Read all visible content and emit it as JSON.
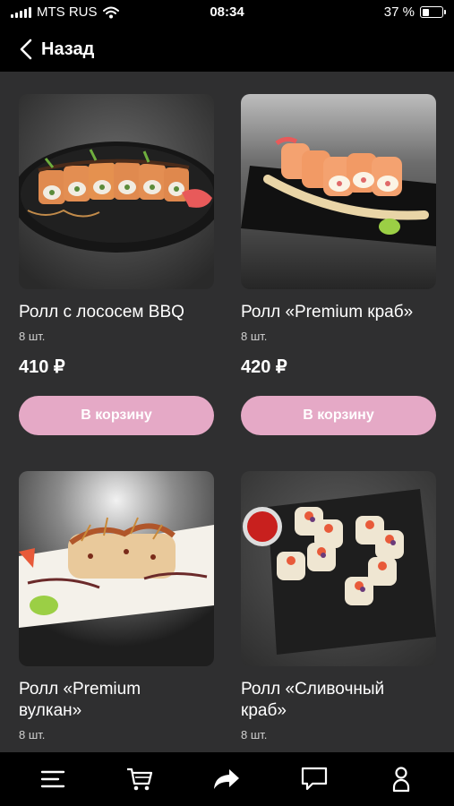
{
  "status_bar": {
    "carrier": "MTS RUS",
    "time": "08:34",
    "battery_percent_label": "37 %",
    "battery_level": 0.37
  },
  "nav": {
    "back_label": "Назад"
  },
  "products": [
    {
      "title": "Ролл с  лососем BBQ",
      "quantity": "8 шт.",
      "price": "410 ₽",
      "button": "В корзину",
      "image": "salmon-bbq-roll-photo"
    },
    {
      "title": "Ролл «Premium краб»",
      "quantity": "8 шт.",
      "price": "420 ₽",
      "button": "В корзину",
      "image": "premium-crab-roll-photo"
    },
    {
      "title": "Ролл «Premium\nвулкан»",
      "quantity": "8 шт.",
      "price": "",
      "button": "",
      "image": "premium-volcano-roll-photo"
    },
    {
      "title": "Ролл «Сливочный\nкраб»",
      "quantity": "8 шт.",
      "price": "",
      "button": "",
      "image": "creamy-crab-roll-photo"
    }
  ],
  "tab_bar": {
    "items": [
      "menu-icon",
      "cart-icon",
      "share-icon",
      "chat-icon",
      "profile-icon"
    ]
  },
  "colors": {
    "accent": "#e5a9c6",
    "background": "#2f2f30",
    "bars": "#000000"
  }
}
